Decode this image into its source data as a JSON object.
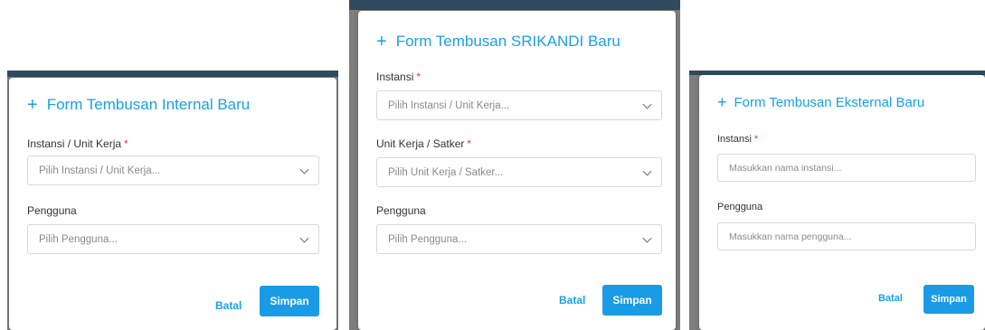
{
  "internal": {
    "title": "Form Tembusan Internal Baru",
    "field1_label": "Instansi / Unit Kerja",
    "field1_placeholder": "Pilih Instansi / Unit Kerja...",
    "field2_label": "Pengguna",
    "field2_placeholder": "Pilih Pengguna...",
    "cancel_label": "Batal",
    "save_label": "Simpan"
  },
  "srikandi": {
    "title": "Form Tembusan SRIKANDI Baru",
    "field1_label": "Instansi",
    "field1_placeholder": "Pilih Instansi / Unit Kerja...",
    "field2_label": "Unit Kerja / Satker",
    "field2_placeholder": "Pilih Unit Kerja / Satker...",
    "field3_label": "Pengguna",
    "field3_placeholder": "Pilih Pengguna...",
    "cancel_label": "Batal",
    "save_label": "Simpan"
  },
  "eksternal": {
    "title": "Form Tembusan Eksternal Baru",
    "field1_label": "Instansi",
    "field1_placeholder": "Masukkan nama instansi...",
    "field2_label": "Pengguna",
    "field2_placeholder": "Masukkan nama pengguna...",
    "cancel_label": "Batal",
    "save_label": "Simpan"
  },
  "plus_symbol": "+",
  "required_mark": "*",
  "colors": {
    "accent": "#1aa0e8",
    "primary_button": "#1a9be6",
    "required": "#e53935"
  }
}
